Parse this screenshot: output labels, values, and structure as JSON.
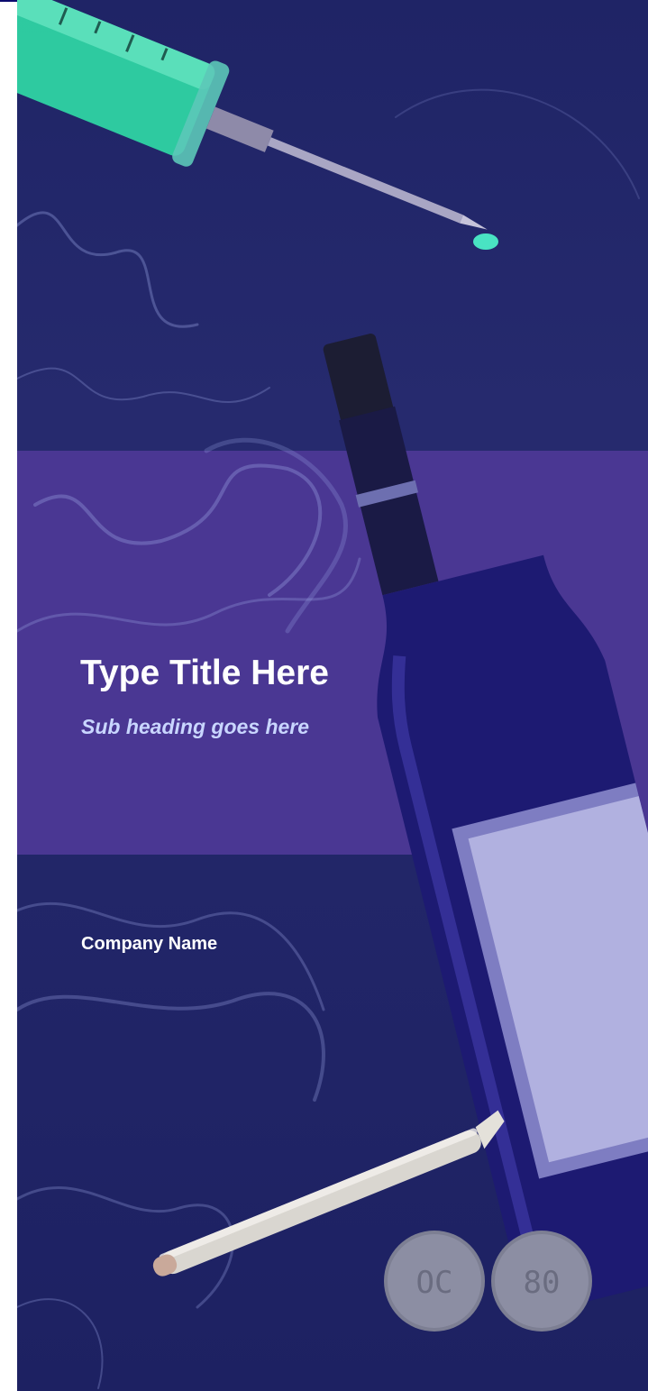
{
  "cover": {
    "title": "Type Title Here",
    "subtitle": "Sub heading goes here",
    "company": "Company Name"
  },
  "images": {
    "syringe": "syringe-icon",
    "wine_bottle": "wine-bottle-icon",
    "joint": "joint-icon",
    "pills": [
      {
        "label": "OC"
      },
      {
        "label": "80"
      }
    ],
    "smoke": "smoke-wisps"
  },
  "colors": {
    "background": "#1f2466",
    "band": "#4a3793",
    "title": "#ffffff",
    "subtitle": "#c9d6ff"
  }
}
